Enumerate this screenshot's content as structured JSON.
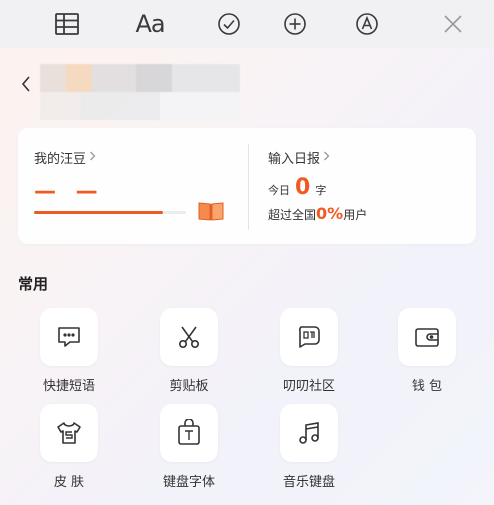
{
  "toolbar": {
    "items": [
      {
        "name": "table-icon"
      },
      {
        "label": "Aa",
        "name": "font-style-icon"
      },
      {
        "name": "check-circle-icon"
      },
      {
        "name": "plus-circle-icon"
      },
      {
        "name": "handwriting-icon"
      },
      {
        "name": "close-icon"
      }
    ]
  },
  "header": {
    "back_glyph": "<"
  },
  "stats_card": {
    "beans_title": "我的汪豆",
    "beans_value": "— —",
    "beans_progress": 0.85,
    "report_title": "输入日报",
    "today_prefix": "今日",
    "today_count": "0",
    "today_unit": "字",
    "beat_prefix": "超过全国",
    "beat_percent": "0%",
    "beat_suffix": "用户",
    "accent_color": "#f05a22"
  },
  "section": {
    "title": "常用"
  },
  "tiles": [
    {
      "label": "快捷短语",
      "icon": "quick-phrase-icon"
    },
    {
      "label": "剪贴板",
      "icon": "scissors-icon"
    },
    {
      "label": "叨叨社区",
      "icon": "community-icon"
    },
    {
      "label": "钱 包",
      "icon": "wallet-icon"
    },
    {
      "label": "皮 肤",
      "icon": "skin-shirt-icon"
    },
    {
      "label": "键盘字体",
      "icon": "keyboard-font-icon"
    },
    {
      "label": "音乐键盘",
      "icon": "music-note-icon"
    }
  ]
}
